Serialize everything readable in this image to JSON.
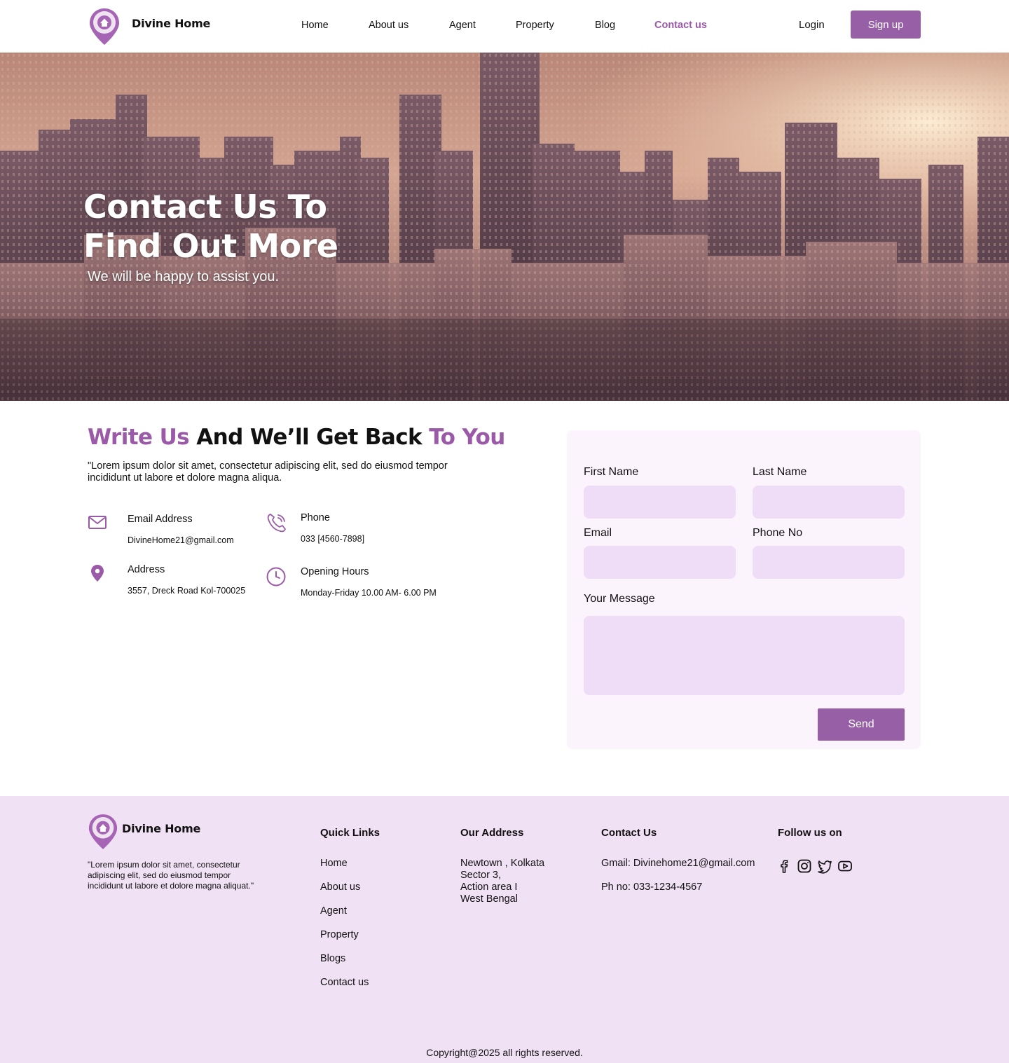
{
  "brand": {
    "name": "Divine Home",
    "accent": "#965fa6",
    "accent_text": "#9b5aa8",
    "input_bg": "#efdcf6",
    "footer_bg": "#f1e1f5"
  },
  "nav": {
    "items": [
      "Home",
      "About us",
      "Agent",
      "Property",
      "Blog",
      "Contact us"
    ],
    "active": "Contact us",
    "login": "Login",
    "signup": "Sign up"
  },
  "hero": {
    "title_line1": "Contact Us To",
    "title_line2": "Find Out More",
    "subtitle": "We will be happy to assist you."
  },
  "contact": {
    "title_part1": "Write Us",
    "title_part2": " And We’ll Get Back ",
    "title_part3": "To You",
    "description": "\"Lorem ipsum dolor sit amet, consectetur adipiscing elit, sed do eiusmod tempor incididunt ut labore et dolore magna aliqua.",
    "email_label": "Email Address",
    "email_value": "DivineHome21@gmail.com",
    "phone_label": "Phone",
    "phone_value": "033 [4560-7898]",
    "address_label": "Address",
    "address_value": "3557, Dreck Road Kol-700025",
    "hours_label": "Opening Hours",
    "hours_value": "Monday-Friday 10.00 AM- 6.00 PM"
  },
  "form": {
    "first_name": "First Name",
    "last_name": "Last Name",
    "email": "Email",
    "phone": "Phone No",
    "message": "Your Message",
    "send": "Send"
  },
  "footer": {
    "brand": "Divine Home",
    "description": "\"Lorem ipsum dolor sit amet, consectetur adipiscing elit, sed do eiusmod tempor incididunt ut labore et dolore magna aliquat.\"",
    "quick_links_title": "Quick Links",
    "quick_links": [
      "Home",
      "About us",
      "Agent",
      "Property",
      "Blogs",
      "Contact us"
    ],
    "address_title": "Our Address",
    "address_lines": [
      "Newtown , Kolkata",
      "Sector 3,",
      "Action area I",
      "West Bengal"
    ],
    "contact_title": "Contact Us",
    "contact_gmail": "Gmail: Divinehome21@gmail.com",
    "contact_phone": "Ph no: 033-1234-4567",
    "follow_title": "Follow us on",
    "socials": [
      "facebook-icon",
      "instagram-icon",
      "twitter-icon",
      "youtube-icon"
    ],
    "copyright": "Copyright@2025 all rights reserved."
  }
}
